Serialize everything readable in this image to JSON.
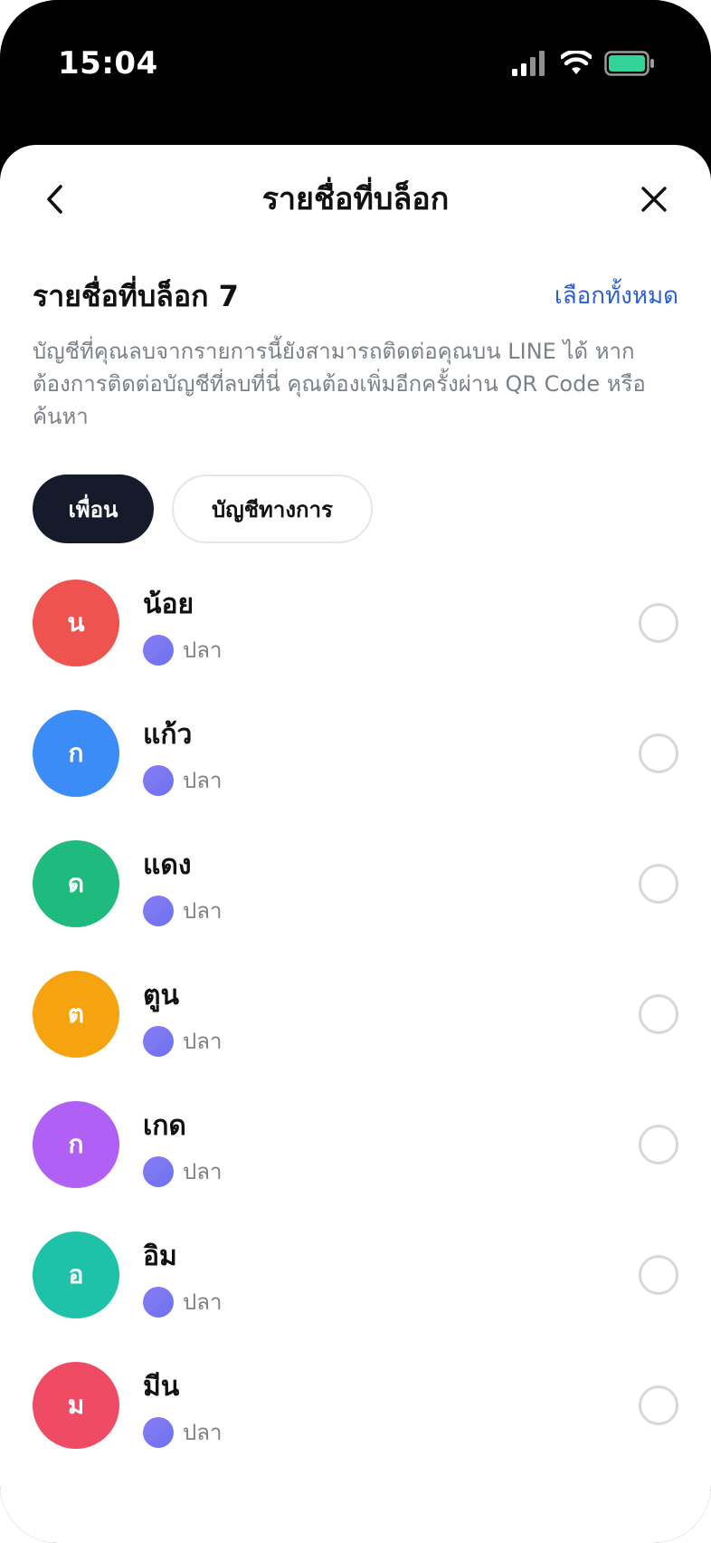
{
  "status_bar": {
    "time": "15:04"
  },
  "nav": {
    "title": "รายชื่อที่บล็อก"
  },
  "section": {
    "title": "รายชื่อที่บล็อก 7",
    "select_all": "เลือกทั้งหมด",
    "description": "บัญชีที่คุณลบจากรายการนี้ยังสามารถติดต่อคุณบน LINE ได้ หากต้องการติดต่อบัญชีที่ลบที่นี่ คุณต้องเพิ่มอีกครั้งผ่าน QR Code หรือค้นหา"
  },
  "tabs": [
    {
      "label": "เพื่อน",
      "active": true
    },
    {
      "label": "บัญชีทางการ",
      "active": false
    }
  ],
  "contacts": [
    {
      "initial": "น",
      "name": "น้อย",
      "sub": "ปลา",
      "color": "#ef5350"
    },
    {
      "initial": "ก",
      "name": "แก้ว",
      "sub": "ปลา",
      "color": "#3b8cf6"
    },
    {
      "initial": "ด",
      "name": "แดง",
      "sub": "ปลา",
      "color": "#1fba7e"
    },
    {
      "initial": "ต",
      "name": "ตูน",
      "sub": "ปลา",
      "color": "#f5a30f"
    },
    {
      "initial": "ก",
      "name": "เกด",
      "sub": "ปลา",
      "color": "#b060f5"
    },
    {
      "initial": "อ",
      "name": "อิม",
      "sub": "ปลา",
      "color": "#1ec2a8"
    },
    {
      "initial": "ม",
      "name": "มีน",
      "sub": "ปลา",
      "color": "#ef4b64"
    }
  ],
  "colors": {
    "accent": "#2b5fd9",
    "tab_active": "#151b2b",
    "battery": "#34d399"
  }
}
